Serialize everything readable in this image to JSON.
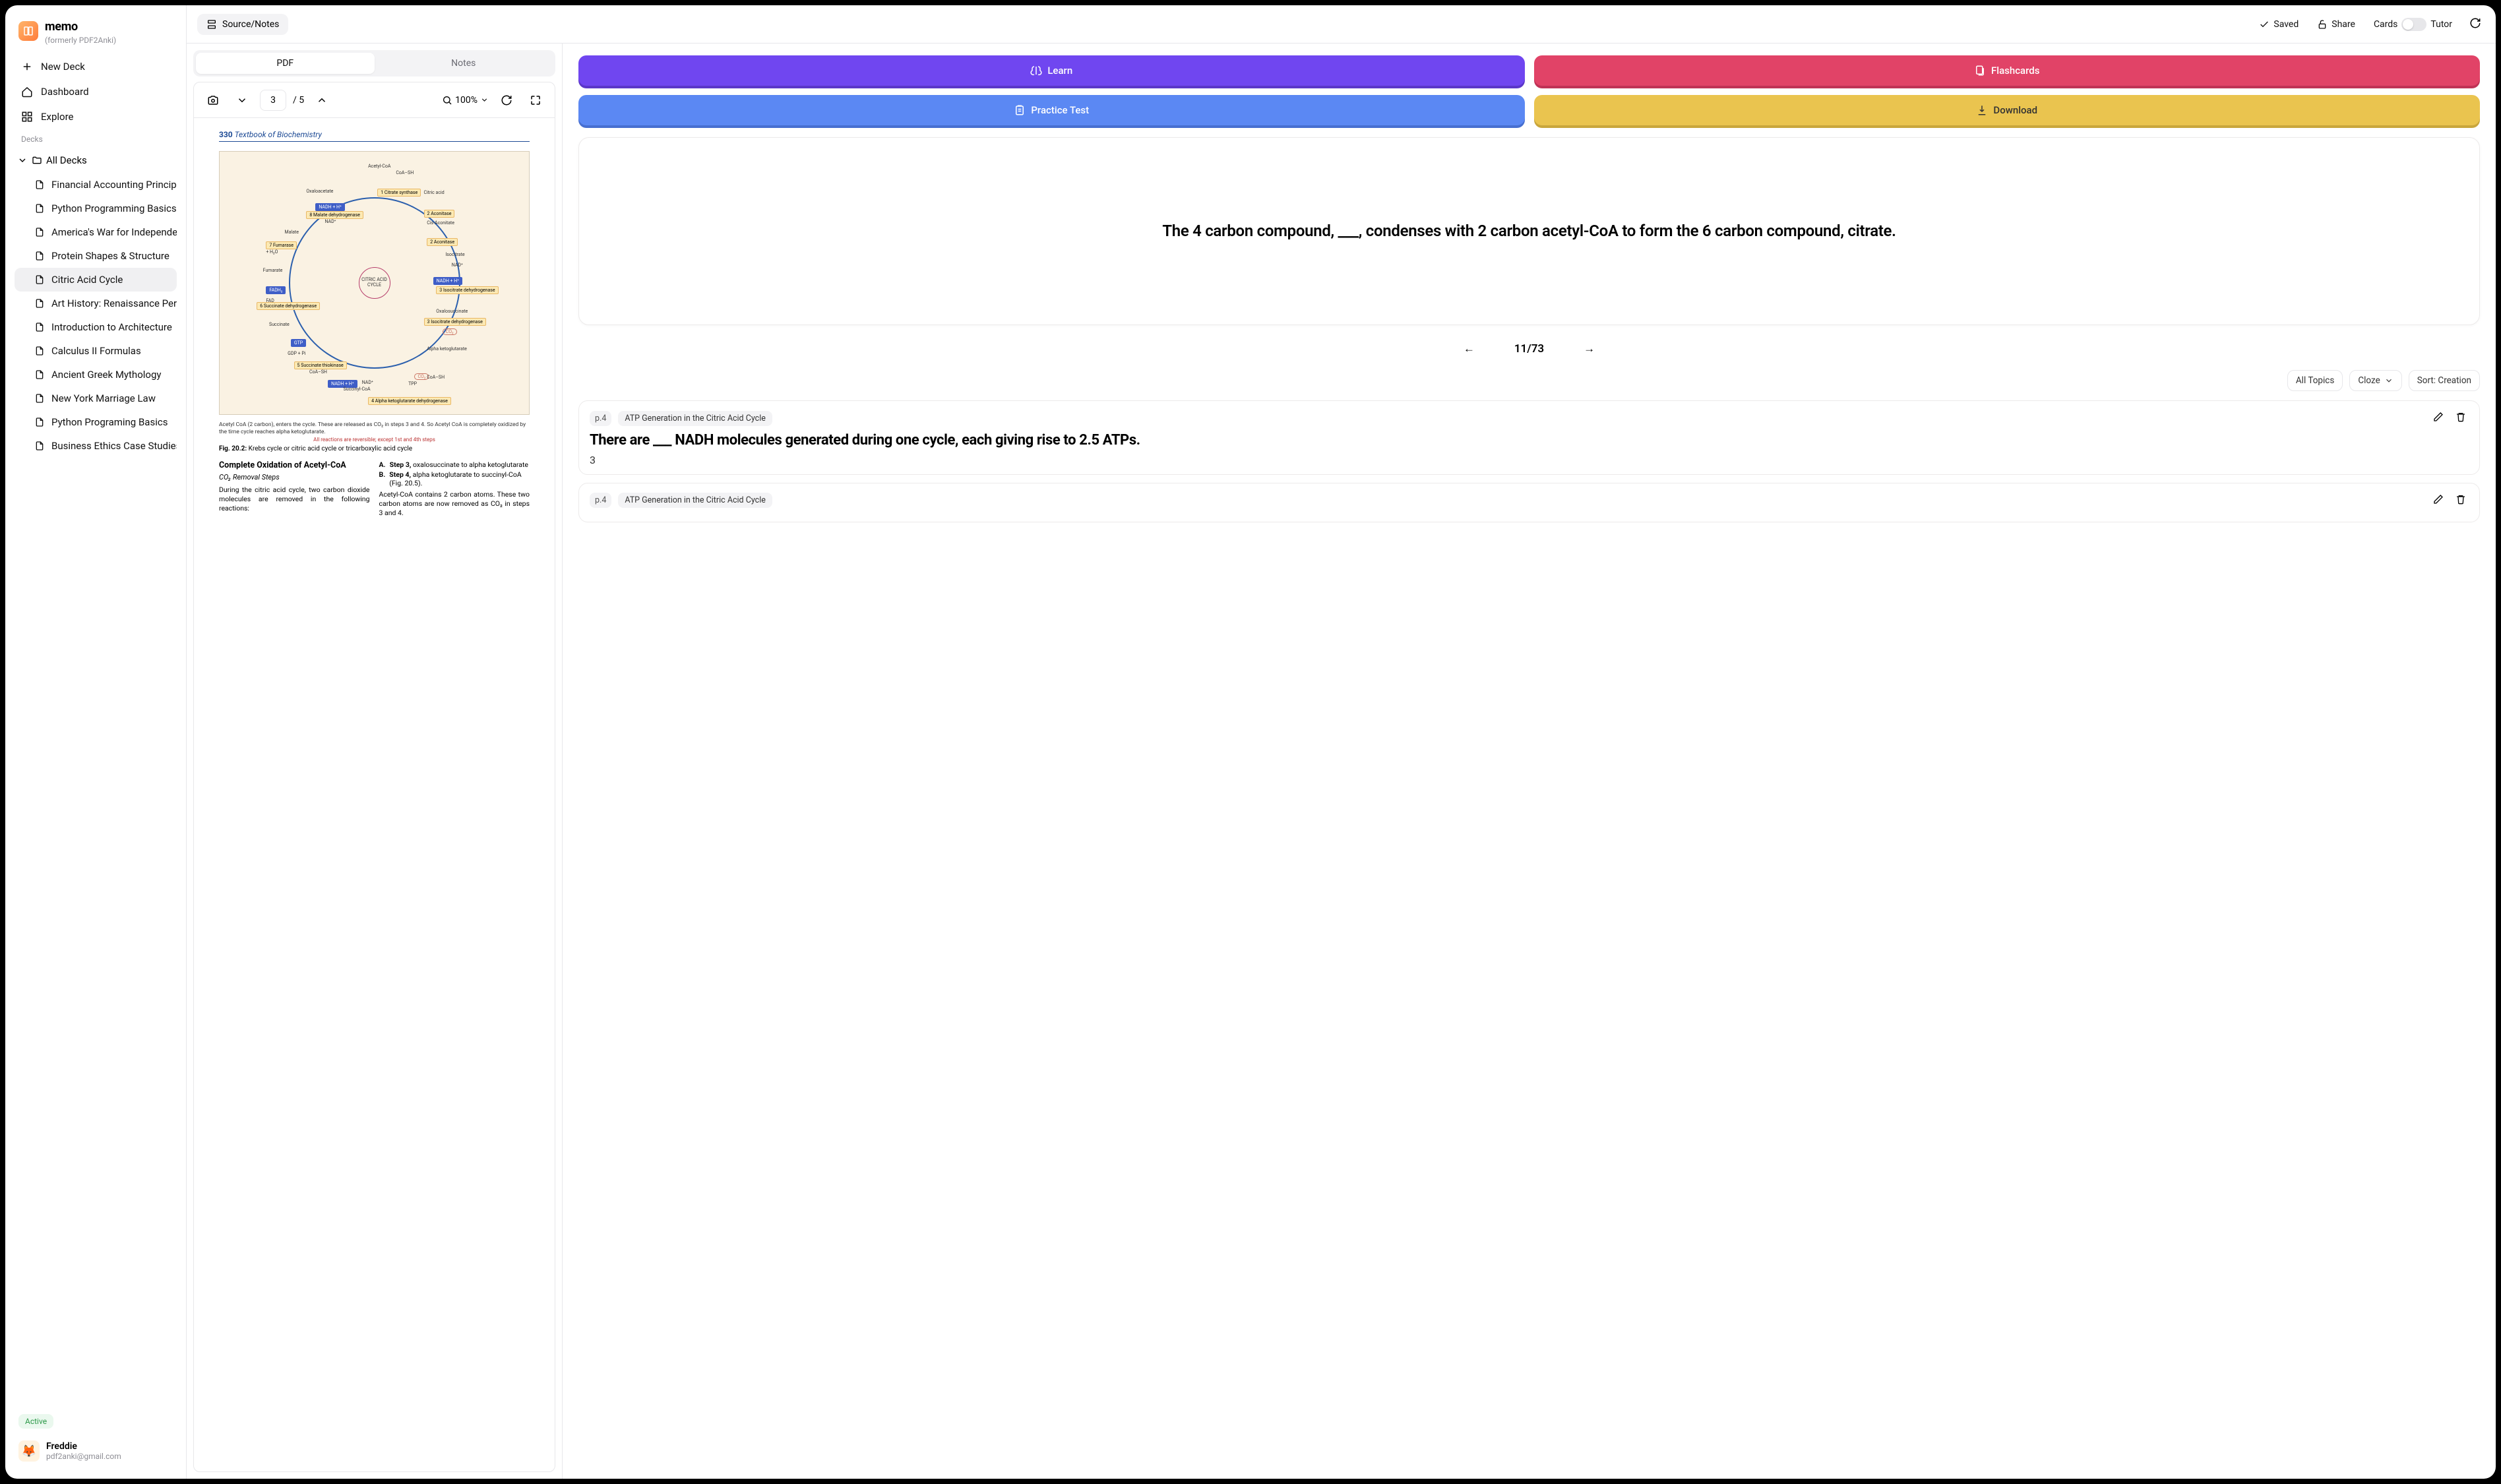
{
  "brand": {
    "name": "memo",
    "subtitle": "(formerly PDF2Anki)"
  },
  "nav": {
    "new_deck": "New Deck",
    "dashboard": "Dashboard",
    "explore": "Explore"
  },
  "decks_label": "Decks",
  "deck_root": "All Decks",
  "decks": [
    "Financial Accounting Principles",
    "Python Programming Basics",
    "America's War for Independe...",
    "Protein Shapes & Structure",
    "Citric Acid Cycle",
    "Art History: Renaissance Peri...",
    "Introduction to Architecture",
    "Calculus II Formulas",
    "Ancient Greek Mythology",
    "New York Marriage Law",
    "Python Programing Basics",
    "Business Ethics Case Studies"
  ],
  "deck_active_index": 4,
  "status_badge": "Active",
  "user": {
    "name": "Freddie",
    "email": "pdf2anki@gmail.com"
  },
  "topbar": {
    "source_notes": "Source/Notes",
    "saved": "Saved",
    "share": "Share",
    "cards": "Cards",
    "tutor": "Tutor"
  },
  "view_tabs": {
    "pdf": "PDF",
    "notes": "Notes",
    "active": "pdf"
  },
  "pdf": {
    "current_page": "3",
    "page_sep": " / ",
    "total_pages": "5",
    "zoom": "100%"
  },
  "page_content": {
    "page_num": "330",
    "book_title": "Textbook of Biochemistry",
    "fig_center": "CITRIC\nACID\nCYCLE",
    "caption_bold": "Fig. 20.2:",
    "caption_text": "Krebs cycle or citric acid cycle or tricarboxylic acid cycle",
    "note1": "Acetyl CoA (2 carbon), enters the cycle. These are released as CO₂ in steps 3 and 4. So Acetyl CoA is completely oxidized by the time cycle reaches alpha ketoglutarate.",
    "redline": "All reactions are reversible; except 1st and 4th steps",
    "left_h1": "Complete Oxidation of Acetyl-CoA",
    "left_sub": "CO₂ Removal Steps",
    "left_body": "During the citric acid cycle, two carbon dioxide molecules are removed in the following reactions:",
    "right_steps": [
      {
        "letter": "A.",
        "step_label": "Step 3,",
        "text": "oxalosuccinate to alpha ketoglutarate"
      },
      {
        "letter": "B.",
        "step_label": "Step 4,",
        "text": "alpha ketoglutarate to succinyl-CoA (Fig. 20.5)."
      }
    ],
    "right_body": "Acetyl-CoA contains 2 carbon atoms. These two carbon atoms are now removed as CO₂ in steps 3 and 4.",
    "fig_labels": {
      "acetyl": "Acetyl-CoA",
      "coash": "CoA–SH",
      "oxaloacetate": "Oxaloacetate",
      "citric_acid": "Citric acid",
      "cis_aconitate": "Cis-Aconitate",
      "isocitrate": "Isocitrate",
      "oxalosuccinate": "Oxalosuccinate",
      "alpha_kg": "Alpha ketoglutarate",
      "succinyl": "Succinyl-CoA",
      "succinate": "Succinate",
      "fumarate": "Fumarate",
      "malate": "Malate",
      "nad": "NAD⁺",
      "nadh": "NADH + H⁺",
      "fad": "FAD",
      "fadh2": "FADH₂",
      "gtp": "GTP",
      "gdp_pi": "GDP + Pi",
      "tpp": "TPP",
      "h2o": "+ H₂O",
      "citrate_synthase": "1 Citrate synthase",
      "aconitase2a": "2 Aconitase",
      "aconitase2b": "2 Aconitase",
      "iso_dh": "3 Isocitrate dehydrogenase",
      "iso_dh2": "3 Isocitrate dehydrogenase",
      "akg_dh": "4 Alpha ketoglutarate dehydrogenase",
      "succ_thio": "5 Succinate thiokinase",
      "succ_dh": "6 Succinate dehydrogenase",
      "fumarase": "7 Fumarase",
      "malate_dh": "8 Malate dehydrogenase",
      "co2": "CO₂"
    }
  },
  "actions": {
    "learn": "Learn",
    "flashcards": "Flashcards",
    "practice_test": "Practice Test",
    "download": "Download"
  },
  "featured_card": {
    "question": "The 4 carbon compound, ___, condenses with 2 carbon acetyl-CoA to form the 6 carbon compound, citrate.",
    "position": "11/73"
  },
  "filters": {
    "all_topics": "All Topics",
    "cloze": "Cloze",
    "sort": "Sort: Creation"
  },
  "list_cards": [
    {
      "page": "p.4",
      "topic": "ATP Generation in the Citric Acid Cycle",
      "question": "There are ___ NADH molecules generated during one cycle, each giving rise to 2.5 ATPs.",
      "answer": "3"
    },
    {
      "page": "p.4",
      "topic": "ATP Generation in the Citric Acid Cycle",
      "question": "",
      "answer": ""
    }
  ]
}
